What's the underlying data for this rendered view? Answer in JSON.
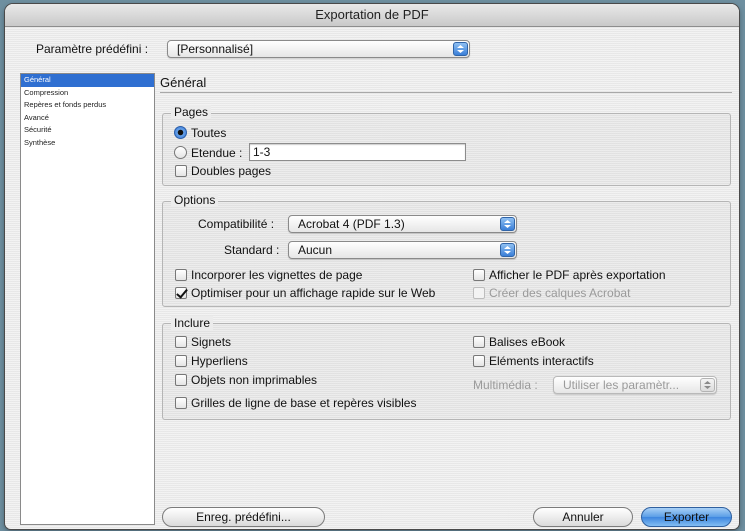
{
  "window": {
    "title": "Exportation de PDF"
  },
  "preset": {
    "label": "Paramètre prédéfini :",
    "value": "[Personnalisé]"
  },
  "sidebar": {
    "items": [
      {
        "label": "Général",
        "selected": true
      },
      {
        "label": "Compression",
        "selected": false
      },
      {
        "label": "Repères et fonds perdus",
        "selected": false
      },
      {
        "label": "Avancé",
        "selected": false
      },
      {
        "label": "Sécurité",
        "selected": false
      },
      {
        "label": "Synthèse",
        "selected": false
      }
    ]
  },
  "panel": {
    "heading": "Général",
    "pages": {
      "title": "Pages",
      "all_label": "Toutes",
      "all_selected": true,
      "range_label": "Etendue :",
      "range_selected": false,
      "range_value": "1-3",
      "spreads_label": "Doubles pages",
      "spreads_checked": false
    },
    "options": {
      "title": "Options",
      "compat_label": "Compatibilité :",
      "compat_value": "Acrobat 4 (PDF 1.3)",
      "standard_label": "Standard :",
      "standard_value": "Aucun",
      "embed_thumbs_label": "Incorporer les vignettes de page",
      "embed_thumbs_checked": false,
      "optimize_label": "Optimiser pour un affichage rapide sur le Web",
      "optimize_checked": true,
      "view_after_label": "Afficher le PDF après exportation",
      "view_after_checked": false,
      "acrobat_layers_label": "Créer des calques Acrobat",
      "acrobat_layers_enabled": false
    },
    "include": {
      "title": "Inclure",
      "bookmarks_label": "Signets",
      "hyperlinks_label": "Hyperliens",
      "nonprinting_label": "Objets non imprimables",
      "grids_label": "Grilles de ligne de base et repères visibles",
      "ebook_tags_label": "Balises eBook",
      "interactive_label": "Eléments interactifs",
      "multimedia_label": "Multimédia :",
      "multimedia_value": "Utiliser les paramètr..."
    }
  },
  "buttons": {
    "save_preset": "Enreg. prédéfini...",
    "cancel": "Annuler",
    "export": "Exporter"
  },
  "colors": {
    "selection": "#2f6fd1",
    "default_button": "#5a9de6",
    "desktop": "#6e8fa0"
  }
}
